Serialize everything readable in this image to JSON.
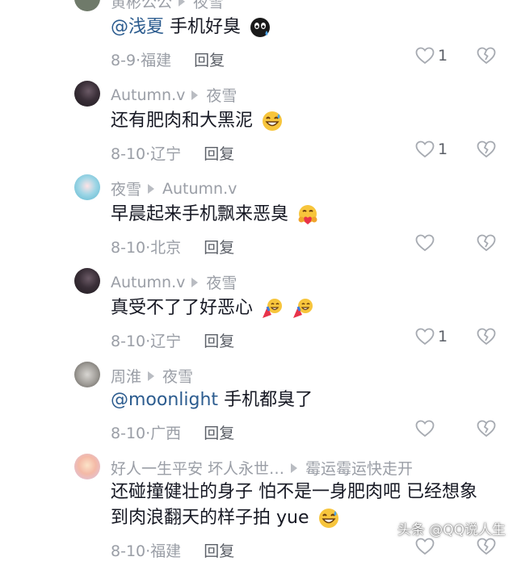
{
  "replies": [
    {
      "author": "黄彬公公",
      "target": "夜雪",
      "mention": "@浅夏",
      "text": "手机好臭",
      "emoji": "face-with-cold-sweat-emoji",
      "date": "8-9",
      "location": "福建",
      "reply_label": "回复",
      "likes": "1"
    },
    {
      "author": "Autumn.v",
      "target": "夜雪",
      "mention": "",
      "text": "还有肥肉和大黑泥",
      "emoji": "grinning-sweat-emoji",
      "date": "8-10",
      "location": "辽宁",
      "reply_label": "回复",
      "likes": "1"
    },
    {
      "author": "夜雪",
      "target": "Autumn.v",
      "mention": "",
      "text": "早晨起来手机飘来恶臭",
      "emoji": "hugging-heart-emoji",
      "date": "8-10",
      "location": "北京",
      "reply_label": "回复",
      "likes": ""
    },
    {
      "author": "Autumn.v",
      "target": "夜雪",
      "mention": "",
      "text": "真受不了了好恶心",
      "emoji": "celebration-emoji",
      "date": "8-10",
      "location": "辽宁",
      "reply_label": "回复",
      "likes": "1"
    },
    {
      "author": "周淮",
      "target": "夜雪",
      "mention": "@moonlight",
      "text": "手机都臭了",
      "emoji": "",
      "date": "8-10",
      "location": "广西",
      "reply_label": "回复",
      "likes": ""
    },
    {
      "author": "好人一生平安 坏人永世…",
      "target": "霉运霉运快走开",
      "mention": "",
      "text": "还碰撞健壮的身子 怕不是一身肥肉吧 已经想象到肉浪翻天的样子拍 yue",
      "emoji": "grinning-sweat-emoji",
      "date": "8-10",
      "location": "福建",
      "reply_label": "回复",
      "likes": ""
    }
  ],
  "watermark": "头条 @QQ说人生",
  "colors": {
    "text": "#161823",
    "secondary": "#9a9ea6",
    "mention": "#2c5c8f"
  }
}
